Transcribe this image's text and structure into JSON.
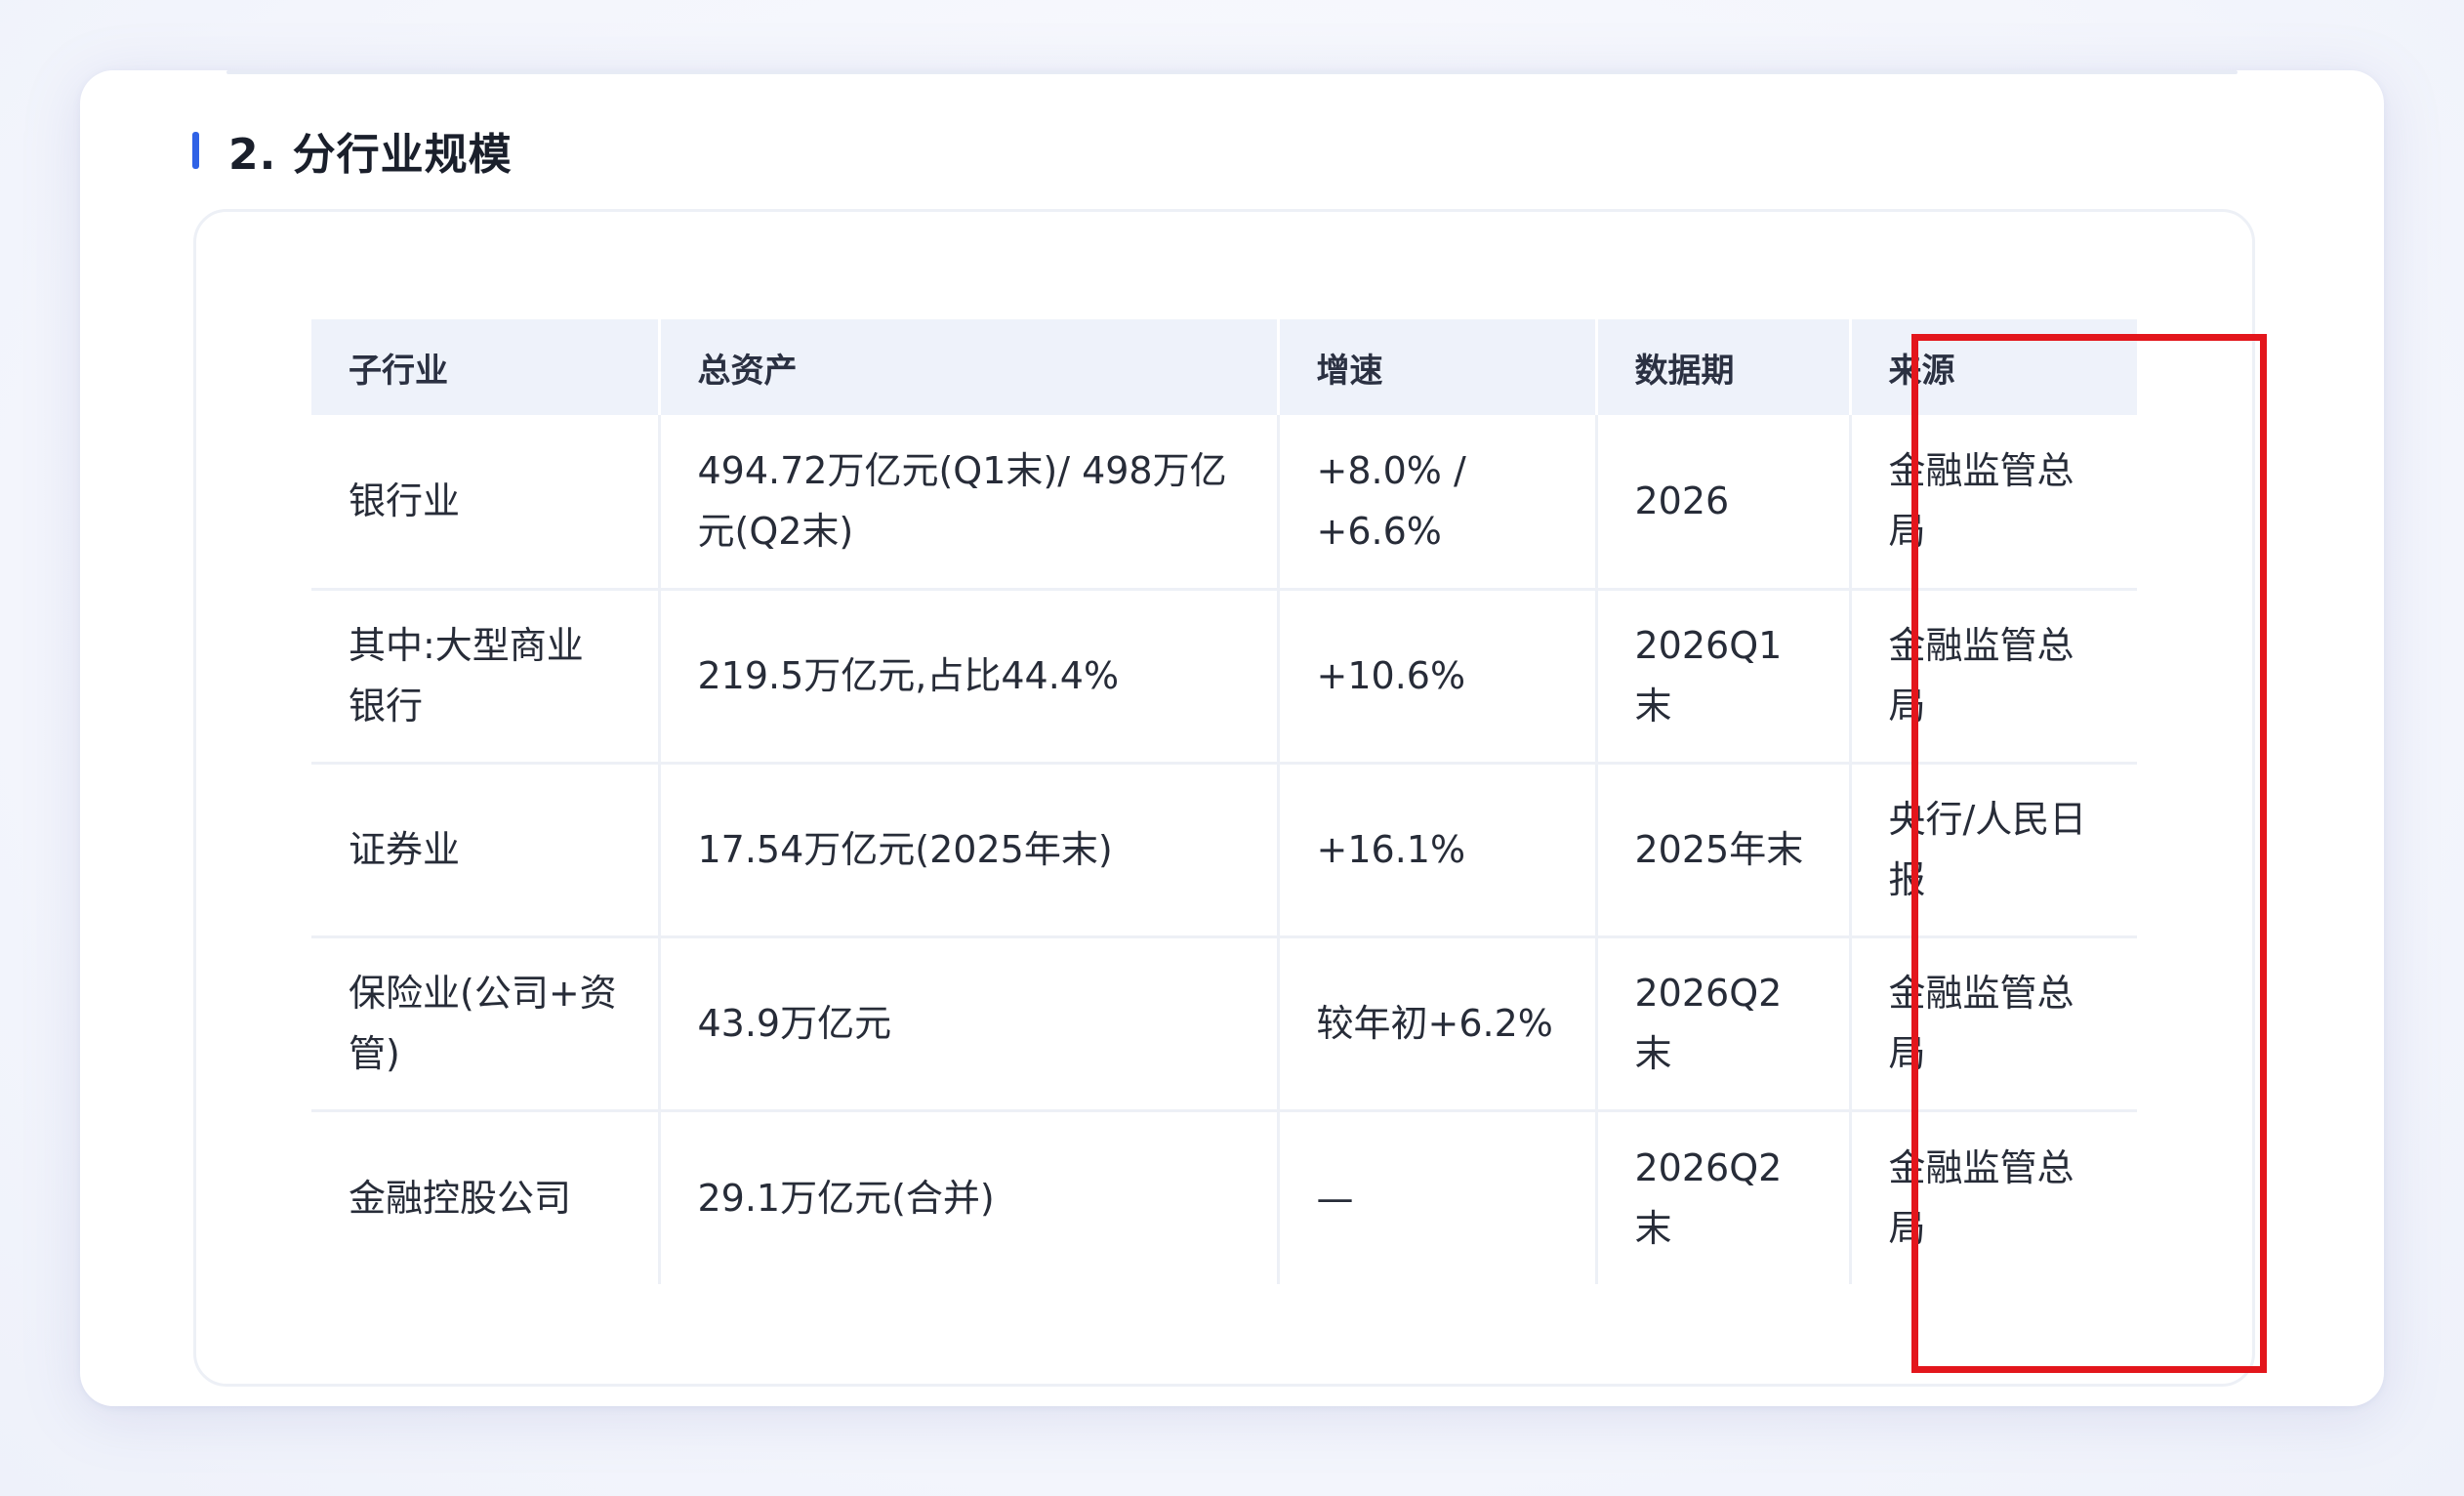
{
  "section": {
    "title": "2. 分行业规模"
  },
  "table": {
    "headers": [
      "子行业",
      "总资产",
      "增速",
      "数据期",
      "来源"
    ],
    "rows": [
      [
        "银行业",
        "494.72万亿元(Q1末)/ 498万亿元(Q2末)",
        "+8.0% / +6.6%",
        "2026",
        "金融监管总局"
      ],
      [
        "其中:大型商业银行",
        "219.5万亿元,占比44.4%",
        "+10.6%",
        "2026Q1末",
        "金融监管总局"
      ],
      [
        "证券业",
        "17.54万亿元(2025年末)",
        "+16.1%",
        "2025年末",
        "央行/人民日报"
      ],
      [
        "保险业(公司+资管)",
        "43.9万亿元",
        "较年初+6.2%",
        "2026Q2末",
        "金融监管总局"
      ],
      [
        "金融控股公司",
        "29.1万亿元(合并)",
        "—",
        "2026Q2末",
        "金融监管总局"
      ]
    ]
  },
  "colors": {
    "accent": "#2f62e6",
    "highlight_border": "#e3161c",
    "header_bg": "#eef2fa"
  }
}
